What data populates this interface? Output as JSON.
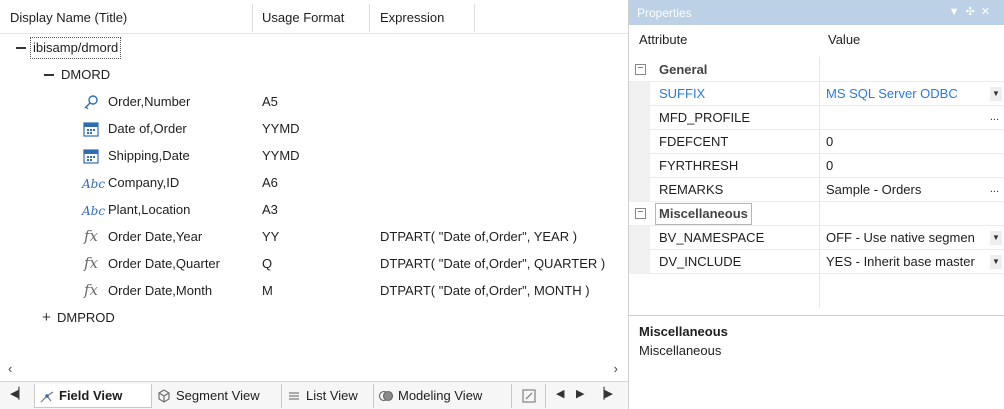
{
  "grid": {
    "columns": [
      "Display Name (Title)",
      "Usage Format",
      "Expression"
    ]
  },
  "tree": {
    "root": "ibisamp/dmord",
    "segment": "DMORD",
    "segment2": "DMPROD",
    "fields": [
      {
        "name": "Order,Number",
        "format": "A5",
        "expression": "",
        "icon": "key-icon"
      },
      {
        "name": "Date of,Order",
        "format": "YYMD",
        "expression": "",
        "icon": "calendar-icon"
      },
      {
        "name": "Shipping,Date",
        "format": "YYMD",
        "expression": "",
        "icon": "calendar-icon"
      },
      {
        "name": "Company,ID",
        "format": "A6",
        "expression": "",
        "icon": "abc-icon"
      },
      {
        "name": "Plant,Location",
        "format": "A3",
        "expression": "",
        "icon": "abc-icon"
      },
      {
        "name": "Order Date,Year",
        "format": "YY",
        "expression": "DTPART( \"Date of,Order\", YEAR )",
        "icon": "fx-icon"
      },
      {
        "name": "Order Date,Quarter",
        "format": "Q",
        "expression": "DTPART( \"Date of,Order\", QUARTER )",
        "icon": "fx-icon"
      },
      {
        "name": "Order Date,Month",
        "format": "M",
        "expression": "DTPART( \"Date of,Order\", MONTH )",
        "icon": "fx-icon"
      }
    ]
  },
  "tabs": [
    "Field View",
    "Segment View",
    "List View",
    "Modeling View"
  ],
  "active_tab": "Field View",
  "properties": {
    "title": "Properties",
    "col_attribute": "Attribute",
    "col_value": "Value",
    "general_label": "General",
    "general": [
      {
        "attr": "SUFFIX",
        "value": "MS SQL Server ODBC"
      },
      {
        "attr": "MFD_PROFILE",
        "value": ""
      },
      {
        "attr": "FDEFCENT",
        "value": "0"
      },
      {
        "attr": "FYRTHRESH",
        "value": "0"
      },
      {
        "attr": "REMARKS",
        "value": "Sample - Orders"
      }
    ],
    "misc_label": "Miscellaneous",
    "misc": [
      {
        "attr": "BV_NAMESPACE",
        "value": "OFF - Use native segmen"
      },
      {
        "attr": "DV_INCLUDE",
        "value": "YES - Inherit base master"
      }
    ],
    "desc_title": "Miscellaneous",
    "desc_text": "Miscellaneous"
  },
  "colors": {
    "accent_blue": "#2b7bd8",
    "title_bar": "#bcd0e6"
  }
}
